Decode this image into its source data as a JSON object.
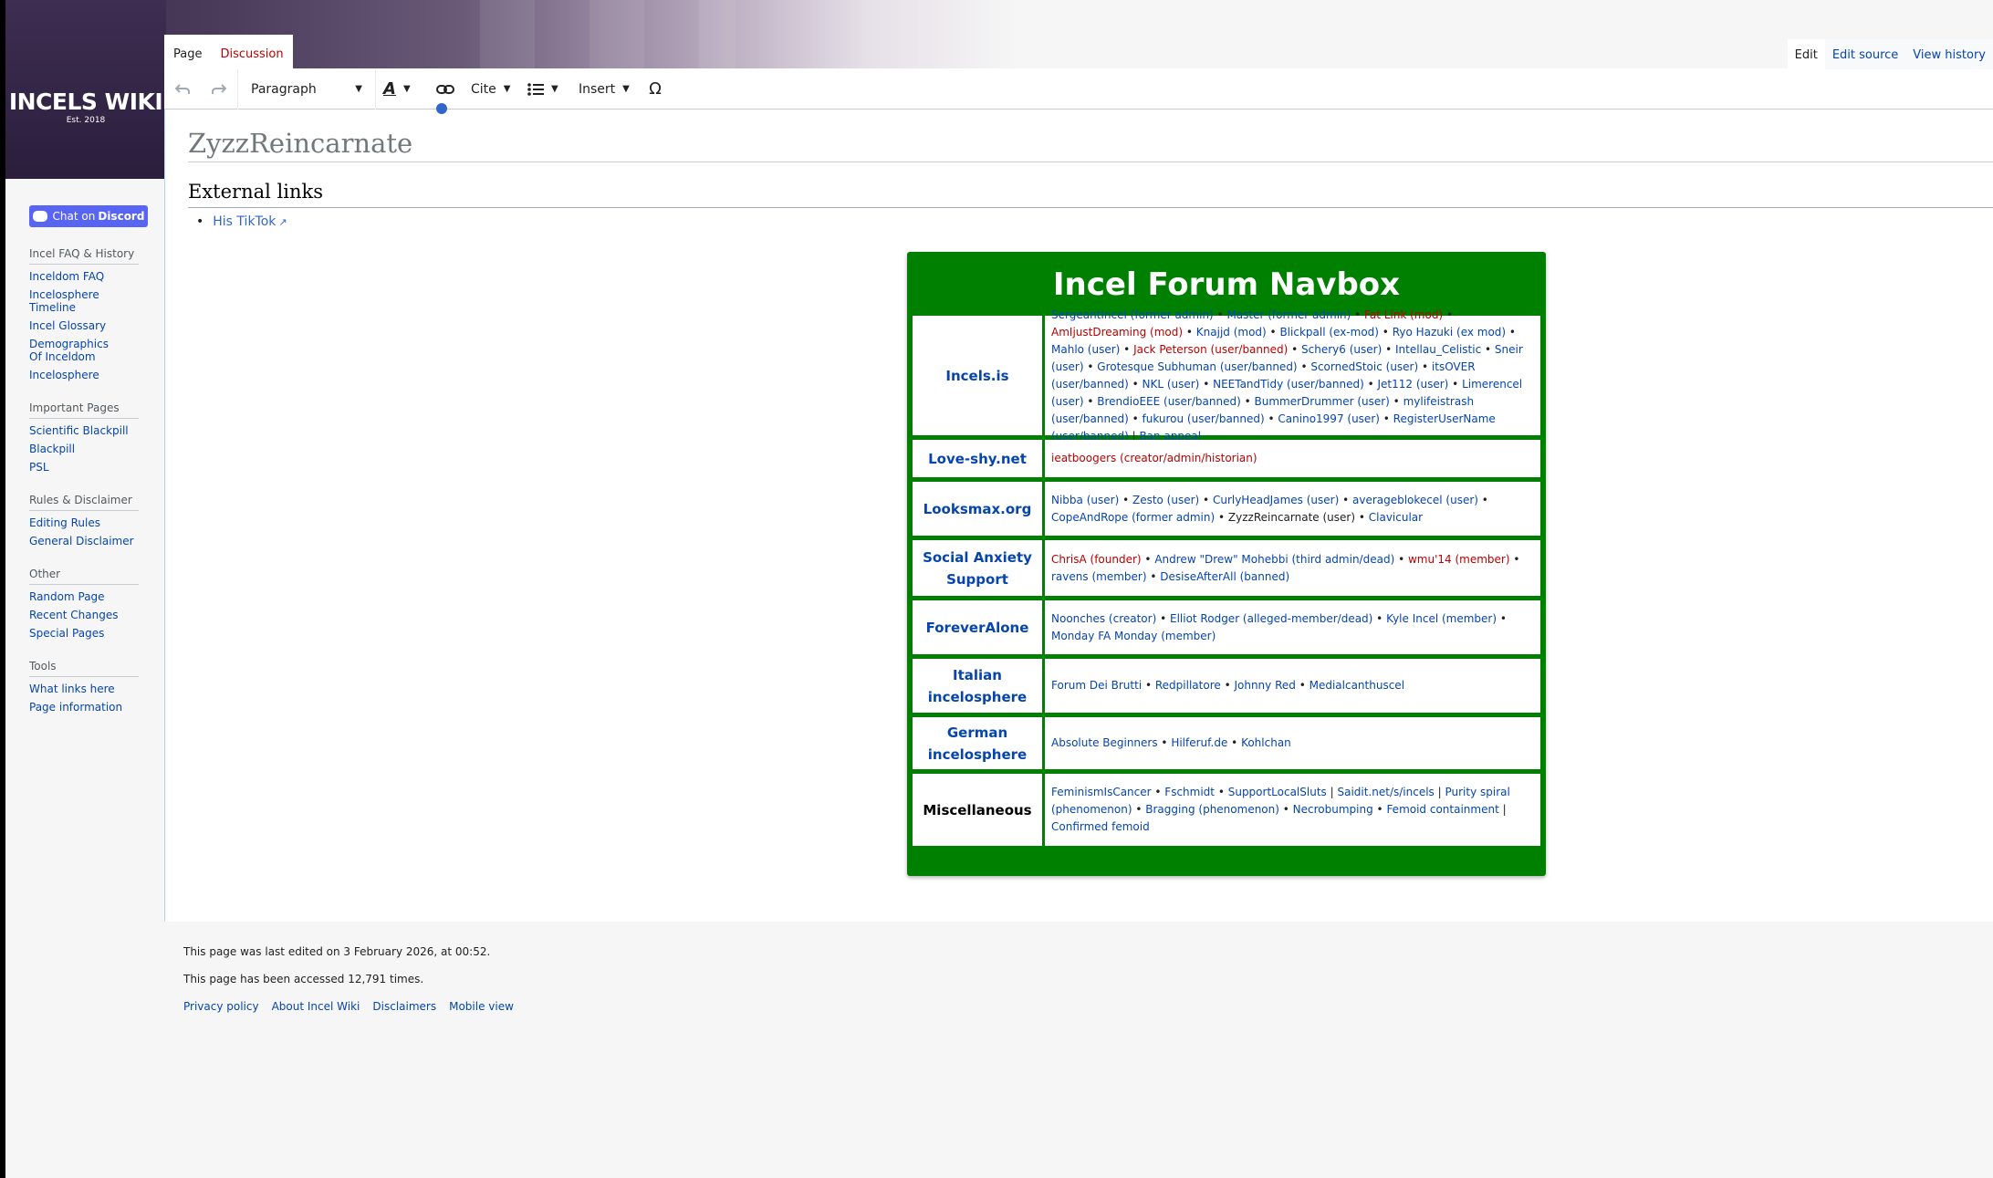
{
  "logo": {
    "title": "INCELS WIKI",
    "subtitle": "Est. 2018"
  },
  "tabs": {
    "page": "Page",
    "discussion": "Discussion",
    "edit": "Edit",
    "edit_source": "Edit source",
    "view_history": "View history"
  },
  "toolbar": {
    "paragraph": "Paragraph",
    "cite": "Cite",
    "insert": "Insert",
    "special_char": "Ω"
  },
  "sidebar": {
    "discord": {
      "prefix": "Chat on",
      "brand": "Discord"
    },
    "portals": [
      {
        "heading": "Incel FAQ & History",
        "links": [
          "Inceldom FAQ",
          "Incelosphere Timeline",
          "Incel Glossary",
          "Demographics Of Inceldom",
          "Incelosphere"
        ]
      },
      {
        "heading": "Important Pages",
        "links": [
          "Scientific Blackpill",
          "Blackpill",
          "PSL"
        ]
      },
      {
        "heading": "Rules & Disclaimer",
        "links": [
          "Editing Rules",
          "General Disclaimer"
        ]
      },
      {
        "heading": "Other",
        "links": [
          "Random Page",
          "Recent Changes",
          "Special Pages"
        ]
      },
      {
        "heading": "Tools",
        "links": [
          "What links here",
          "Page information"
        ]
      }
    ]
  },
  "page": {
    "title": "ZyzzReincarnate",
    "section_heading": "External links",
    "external_link": "His TikTok"
  },
  "navbox": {
    "title": "Incel Forum Navbox",
    "rows": [
      {
        "group": "Incels.is",
        "group_link": true,
        "height": 112,
        "items": [
          [
            "l",
            "SergeantIncel (former admin)"
          ],
          [
            "l",
            "Master (former admin)"
          ],
          [
            "r",
            "Fat Link (mod)"
          ],
          [
            "r",
            "AmIjustDreaming (mod)"
          ],
          [
            "l",
            "Knajjd (mod)"
          ],
          [
            "l",
            "Blickpall (ex-mod)"
          ],
          [
            "l",
            "Ryo Hazuki (ex mod)"
          ],
          [
            "l",
            "Mahlo (user)"
          ],
          [
            "r",
            "Jack Peterson (user/banned)"
          ],
          [
            "l",
            "Schery6 (user)"
          ],
          [
            "l",
            "Intellau_Celistic"
          ],
          [
            "l",
            "Sneir (user)"
          ],
          [
            "l",
            "Grotesque Subhuman (user/banned)"
          ],
          [
            "l",
            "ScornedStoic (user)"
          ],
          [
            "l",
            "itsOVER (user/banned)"
          ],
          [
            "l",
            "NKL (user)"
          ],
          [
            "l",
            "NEETandTidy (user/banned)"
          ],
          [
            "l",
            "Jet112 (user)"
          ],
          [
            "l",
            "Limerencel (user)"
          ],
          [
            "l",
            "BrendioEEE (user/banned)"
          ],
          [
            "l",
            "BummerDrummer (user)"
          ],
          [
            "l",
            "mylifeistrash (user/banned)"
          ],
          [
            "l",
            "fukurou (user/banned)"
          ],
          [
            "l",
            "Canino1997 (user)"
          ],
          [
            "l",
            "RegisterUserName (user/banned)"
          ],
          [
            "sep",
            "|"
          ],
          [
            "l",
            "Ban appeal"
          ]
        ]
      },
      {
        "group": "Love-shy.net",
        "group_link": true,
        "height": 44,
        "items": [
          [
            "r",
            "ieatboogers (creator/admin/historian)"
          ]
        ]
      },
      {
        "group": "Looksmax.org",
        "group_link": true,
        "height": 64,
        "items": [
          [
            "l",
            "Nibba (user)"
          ],
          [
            "l",
            "Zesto (user)"
          ],
          [
            "l",
            "CurlyHeadJames (user)"
          ],
          [
            "l",
            "averageblokecel (user)"
          ],
          [
            "l",
            "CopeAndRope (former admin)"
          ],
          [
            "k",
            "ZyzzReincarnate (user)"
          ],
          [
            "l",
            "Clavicular"
          ]
        ]
      },
      {
        "group": "Social Anxiety Support",
        "group_link": true,
        "height": 64,
        "items": [
          [
            "r",
            "ChrisA (founder)"
          ],
          [
            "l",
            "Andrew \"Drew\" Mohebbi (third admin/dead)"
          ],
          [
            "r",
            "wmu'14 (member)"
          ],
          [
            "l",
            "ravens (member)"
          ],
          [
            "l",
            "DesiseAfterAll (banned)"
          ]
        ]
      },
      {
        "group": "ForeverAlone",
        "group_link": true,
        "height": 64,
        "items": [
          [
            "l",
            "Noonches (creator)"
          ],
          [
            "l",
            "Elliot Rodger (alleged-member/dead)"
          ],
          [
            "l",
            "Kyle Incel (member)"
          ],
          [
            "l",
            "Monday FA Monday (member)"
          ]
        ]
      },
      {
        "group": "Italian incelosphere",
        "group_link": true,
        "height": 60,
        "items": [
          [
            "l",
            "Forum Dei Brutti"
          ],
          [
            "l",
            "Redpillatore"
          ],
          [
            "l",
            "Johnny Red"
          ],
          [
            "l",
            "Medialcanthuscel"
          ]
        ]
      },
      {
        "group": "German incelosphere",
        "group_link": true,
        "height": 60,
        "items": [
          [
            "l",
            "Absolute Beginners"
          ],
          [
            "l",
            "Hilferuf.de"
          ],
          [
            "l",
            "Kohlchan"
          ]
        ]
      },
      {
        "group": "Miscellaneous",
        "group_link": false,
        "height": 84,
        "items": [
          [
            "l",
            "FeminismIsCancer"
          ],
          [
            "l",
            "Fschmidt"
          ],
          [
            "l",
            "SupportLocalSluts"
          ],
          [
            "sep",
            "|"
          ],
          [
            "l",
            "Saidit.net/s/incels"
          ],
          [
            "sep",
            "|"
          ],
          [
            "l",
            "Purity spiral (phenomenon)"
          ],
          [
            "l",
            "Bragging (phenomenon)"
          ],
          [
            "l",
            "Necrobumping"
          ],
          [
            "l",
            "Femoid containment"
          ],
          [
            "sep",
            "|"
          ],
          [
            "l",
            "Confirmed femoid"
          ]
        ]
      }
    ]
  },
  "footer": {
    "last_edited": "This page was last edited on 3 February 2026, at 00:52.",
    "accessed": "This page has been accessed 12,791 times.",
    "links": [
      "Privacy policy",
      "About Incel Wiki",
      "Disclaimers",
      "Mobile view"
    ]
  }
}
